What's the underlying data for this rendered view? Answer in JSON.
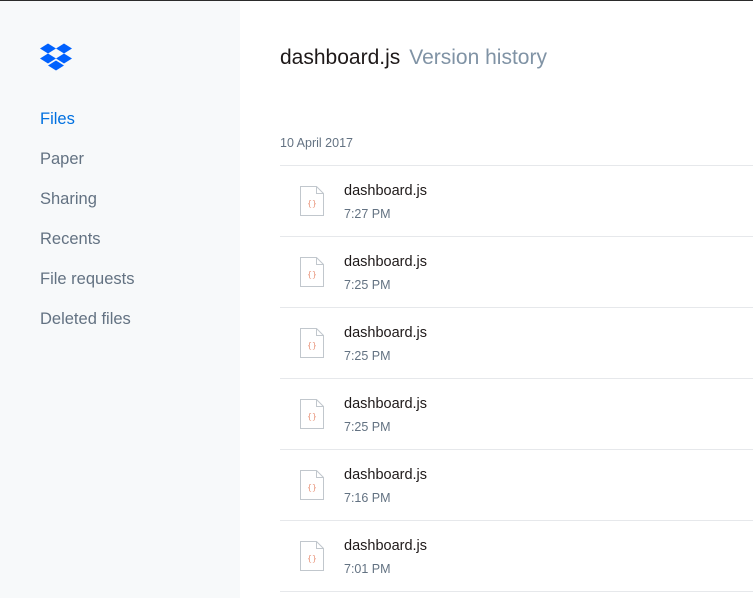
{
  "brand": {
    "logo_icon": "dropbox-icon",
    "color": "#0061fe"
  },
  "sidebar": {
    "items": [
      {
        "label": "Files",
        "active": true
      },
      {
        "label": "Paper",
        "active": false
      },
      {
        "label": "Sharing",
        "active": false
      },
      {
        "label": "Recents",
        "active": false
      },
      {
        "label": "File requests",
        "active": false
      },
      {
        "label": "Deleted files",
        "active": false
      }
    ]
  },
  "header": {
    "filename": "dashboard.js",
    "subtitle": "Version history"
  },
  "versions": {
    "date": "10 April 2017",
    "items": [
      {
        "name": "dashboard.js",
        "time": "7:27 PM",
        "icon": "code-file-icon"
      },
      {
        "name": "dashboard.js",
        "time": "7:25 PM",
        "icon": "code-file-icon"
      },
      {
        "name": "dashboard.js",
        "time": "7:25 PM",
        "icon": "code-file-icon"
      },
      {
        "name": "dashboard.js",
        "time": "7:25 PM",
        "icon": "code-file-icon"
      },
      {
        "name": "dashboard.js",
        "time": "7:16 PM",
        "icon": "code-file-icon"
      },
      {
        "name": "dashboard.js",
        "time": "7:01 PM",
        "icon": "code-file-icon"
      }
    ]
  },
  "colors": {
    "accent": "#0070e0",
    "muted": "#637282",
    "sidebar_bg": "#f7f9fa",
    "icon_brace": "#e8947a"
  }
}
